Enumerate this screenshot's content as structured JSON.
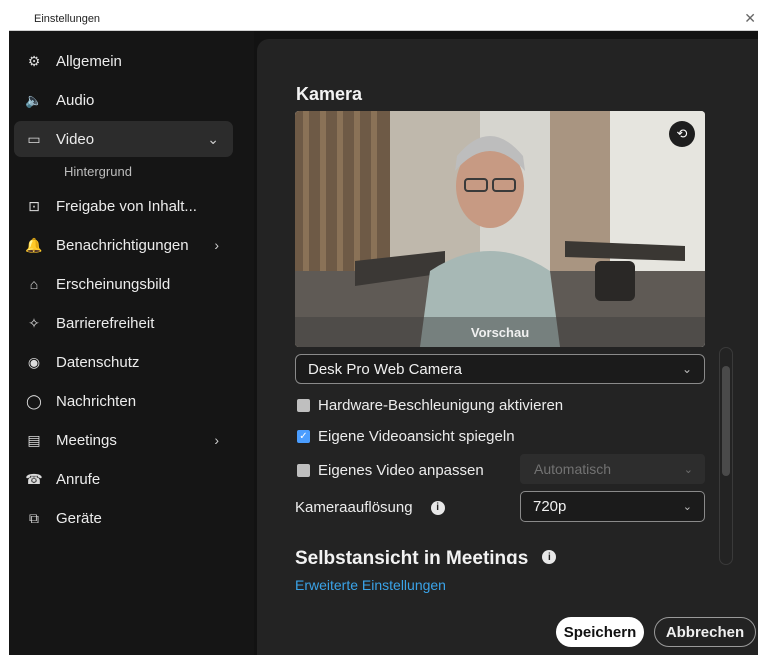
{
  "window": {
    "title": "Einstellungen",
    "close_glyph": "✕"
  },
  "sidebar": {
    "items": [
      {
        "label": "Allgemein",
        "icon": "gear-icon",
        "glyph": "⚙"
      },
      {
        "label": "Audio",
        "icon": "speaker-icon",
        "glyph": "🔈"
      },
      {
        "label": "Video",
        "icon": "video-camera-icon",
        "glyph": "▭"
      },
      {
        "label": "Freigabe von Inhalt...",
        "icon": "share-screen-icon",
        "glyph": "⊡"
      },
      {
        "label": "Benachrichtigungen",
        "icon": "bell-icon",
        "glyph": "🔔"
      },
      {
        "label": "Erscheinungsbild",
        "icon": "appearance-icon",
        "glyph": "⌂"
      },
      {
        "label": "Barrierefreiheit",
        "icon": "accessibility-icon",
        "glyph": "✧"
      },
      {
        "label": "Datenschutz",
        "icon": "privacy-icon",
        "glyph": "◉"
      },
      {
        "label": "Nachrichten",
        "icon": "chat-bubble-icon",
        "glyph": "◯"
      },
      {
        "label": "Meetings",
        "icon": "calendar-icon",
        "glyph": "▤"
      },
      {
        "label": "Anrufe",
        "icon": "phone-icon",
        "glyph": "☎"
      },
      {
        "label": "Geräte",
        "icon": "devices-icon",
        "glyph": "⧉"
      }
    ],
    "video_sub": "Hintergrund",
    "active": "Video"
  },
  "main": {
    "section_title": "Kamera",
    "preview_label": "Vorschau",
    "camera_select": "Desk Pro Web Camera",
    "checkboxes": [
      {
        "label": "Hardware-Beschleunigung aktivieren",
        "checked": false
      },
      {
        "label": "Eigene Videoansicht spiegeln",
        "checked": true
      },
      {
        "label": "Eigenes Video anpassen",
        "checked": false
      }
    ],
    "auto_select": "Automatisch",
    "resolution_label": "Kameraauflösung",
    "resolution_value": "720p",
    "selfview_title": "Selbstansicht in Meetings",
    "link": "Erweiterte Einstellungen"
  },
  "footer": {
    "save": "Speichern",
    "cancel": "Abbrechen"
  },
  "colors": {
    "accent": "#4a9dff",
    "link": "#3aa3e8",
    "background": "#232323",
    "sidebar": "#151515"
  }
}
